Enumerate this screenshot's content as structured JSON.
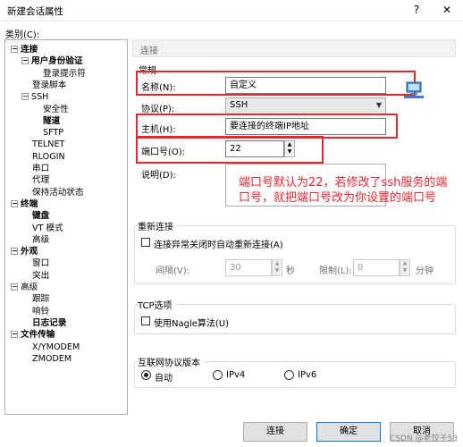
{
  "window": {
    "title": "新建会话属性",
    "help_glyph": "?",
    "close_glyph": "✕"
  },
  "category": {
    "label": "类别(C):",
    "tree": [
      {
        "label": "连接",
        "toggle": "−",
        "bold": true
      },
      {
        "label": "用户身份验证",
        "toggle": "−",
        "bold": true
      },
      {
        "label": "登录提示符",
        "toggle": "",
        "bold": false
      },
      {
        "label": "登录脚本",
        "toggle": "",
        "bold": false
      },
      {
        "label": "SSH",
        "toggle": "−",
        "bold": false
      },
      {
        "label": "安全性",
        "toggle": "",
        "bold": false
      },
      {
        "label": "隧道",
        "toggle": "",
        "bold": true
      },
      {
        "label": "SFTP",
        "toggle": "",
        "bold": false
      },
      {
        "label": "TELNET",
        "toggle": "",
        "bold": false
      },
      {
        "label": "RLOGIN",
        "toggle": "",
        "bold": false
      },
      {
        "label": "串口",
        "toggle": "",
        "bold": false
      },
      {
        "label": "代理",
        "toggle": "",
        "bold": false
      },
      {
        "label": "保持活动状态",
        "toggle": "",
        "bold": false
      },
      {
        "label": "终端",
        "toggle": "−",
        "bold": true
      },
      {
        "label": "键盘",
        "toggle": "",
        "bold": true
      },
      {
        "label": "VT 模式",
        "toggle": "",
        "bold": false
      },
      {
        "label": "高级",
        "toggle": "",
        "bold": false
      },
      {
        "label": "外观",
        "toggle": "−",
        "bold": true
      },
      {
        "label": "窗口",
        "toggle": "",
        "bold": false
      },
      {
        "label": "突出",
        "toggle": "",
        "bold": false
      },
      {
        "label": "高级",
        "toggle": "−",
        "bold": false
      },
      {
        "label": "跟踪",
        "toggle": "",
        "bold": false
      },
      {
        "label": "响铃",
        "toggle": "",
        "bold": false
      },
      {
        "label": "日志记录",
        "toggle": "",
        "bold": true
      },
      {
        "label": "文件传输",
        "toggle": "−",
        "bold": true
      },
      {
        "label": "X/YMODEM",
        "toggle": "",
        "bold": false
      },
      {
        "label": "ZMODEM",
        "toggle": "",
        "bold": false
      }
    ]
  },
  "panel": {
    "header": "连接",
    "section_label": "常规",
    "name_label": "名称(N):",
    "name_value": "自定义",
    "protocol_label": "协议(P):",
    "protocol_value": "SSH",
    "host_label": "主机(H):",
    "host_value": "要连接的终端IP地址",
    "port_label": "端口号(O):",
    "port_value": "22",
    "desc_label": "说明(D):",
    "annotation": "端口号默认为22，若修改了ssh服务的端口号，就把端口号改为你设置的端口号"
  },
  "reconnect": {
    "title": "重新连接",
    "checkbox_label": "连接异常关闭时自动重新连接(A)",
    "checked": false,
    "interval_label": "间隔(V):",
    "interval_value": "30",
    "interval_unit": "秒",
    "limit_label": "限制(L):",
    "limit_value": "0",
    "limit_unit": "分钟"
  },
  "tcp": {
    "title": "TCP选项",
    "checkbox_label": "使用Nagle算法(U)",
    "checked": false
  },
  "ip_version": {
    "title": "互联网协议版本",
    "options": [
      "自动",
      "IPv4",
      "IPv6"
    ],
    "selected": "自动"
  },
  "buttons": {
    "connect": "连接",
    "ok": "确定",
    "cancel": "取消"
  },
  "watermark": "CSDN @老饺子53",
  "colors": {
    "annotation_red": "#e8262f",
    "default_button_border": "#0078d7"
  }
}
